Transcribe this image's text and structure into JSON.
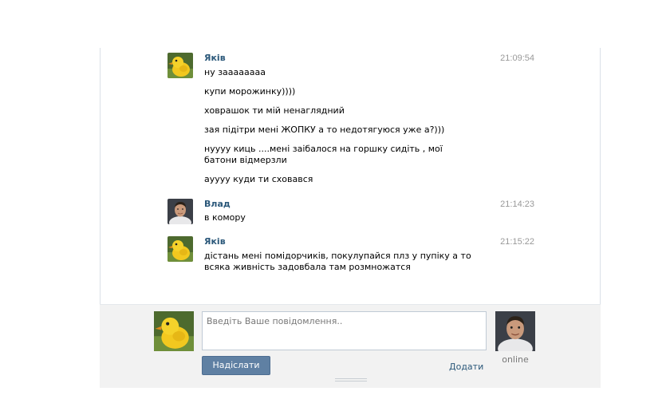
{
  "messages": [
    {
      "author": "Яків",
      "avatar_icon": "chick-avatar-icon",
      "time": "21:09:54",
      "lines": [
        "ну заааааааа",
        "купи морожинку))))",
        "ховрашок ти мій ненаглядний",
        "зая підітри мені ЖОПКУ а то недотягуюся уже а?)))",
        "нуууу киць ....мені заібалося на горшку сидіть , мої батони відмерзли",
        "аyyyy куди ти сховався"
      ]
    },
    {
      "author": "Влад",
      "avatar_icon": "man-avatar-icon",
      "time": "21:14:23",
      "lines": [
        "в комору"
      ]
    },
    {
      "author": "Яків",
      "avatar_icon": "chick-avatar-icon",
      "time": "21:15:22",
      "lines": [
        "дістань мені помідорчиків, покулупайся плз у пупіку а то всяка живність задовбала там розмножатся"
      ]
    }
  ],
  "compose": {
    "placeholder": "Введіть Ваше повідомлення..",
    "value": "",
    "send_label": "Надіслати",
    "add_label": "Додати",
    "partner_status": "online"
  },
  "colors": {
    "author_link": "#2b587a",
    "button_bg": "#5f80a3",
    "compose_bg": "#f2f2f2"
  }
}
